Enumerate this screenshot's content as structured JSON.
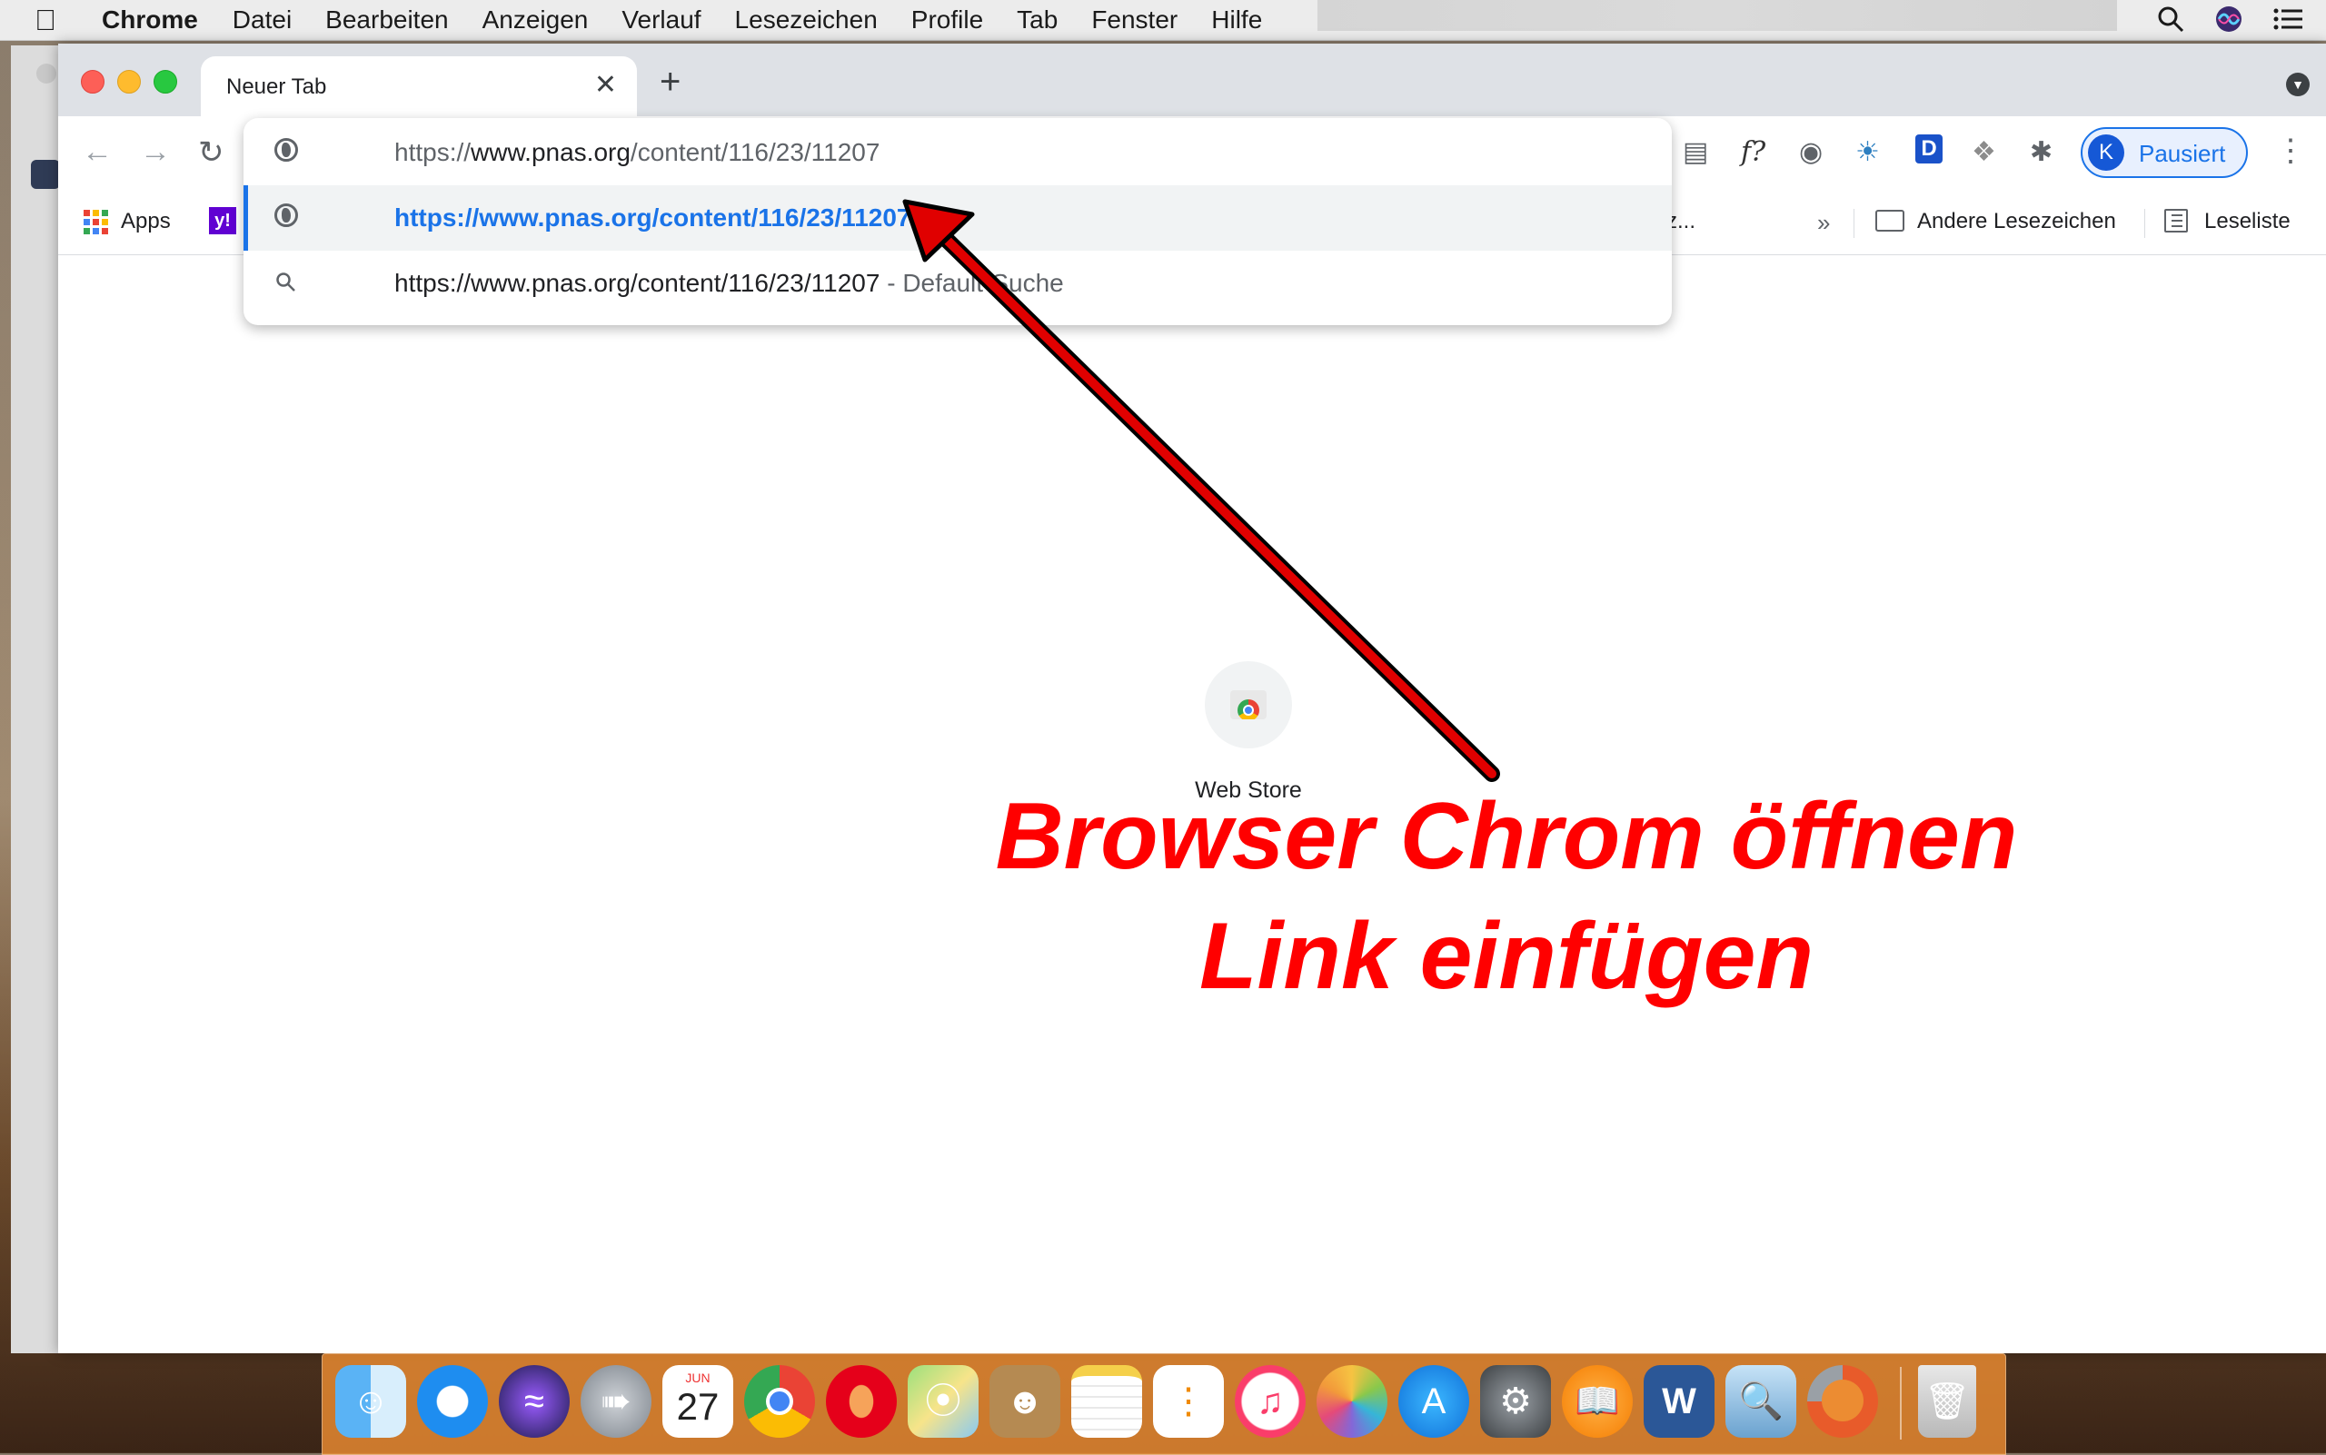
{
  "menubar": {
    "apple": "",
    "app": "Chrome",
    "items": [
      "Datei",
      "Bearbeiten",
      "Anzeigen",
      "Verlauf",
      "Lesezeichen",
      "Profile",
      "Tab",
      "Fenster",
      "Hilfe"
    ]
  },
  "tab": {
    "title": "Neuer Tab",
    "close": "✕"
  },
  "newtab": "+",
  "omnibox": {
    "input_prefix": "https://",
    "input_host": "www.pnas.org",
    "input_path": "/content/116/23/11207",
    "suggestion_url": "https://www.pnas.org/content/116/23/11207",
    "search_query": "https://www.pnas.org/content/116/23/11207",
    "search_suffix": " - Default-Suche"
  },
  "extensions": {
    "fx": "f?",
    "d": "D"
  },
  "profile": {
    "initial": "K",
    "label": "Pausiert"
  },
  "bookmarks": {
    "apps": "Apps",
    "yahoo": "y!",
    "truncated": "z...",
    "more": "»",
    "other": "Andere Lesezeichen",
    "reading": "Leseliste"
  },
  "shortcut": {
    "label": "Web Store"
  },
  "annotation": {
    "line1": "Browser Chrom öffnen",
    "line2": "Link einfügen",
    "color": "#ff0000"
  },
  "dock": {
    "calendar_month": "JUN",
    "calendar_day": "27",
    "word": "W"
  },
  "colors": {
    "accent": "#1a73e8",
    "tabstrip": "#dee1e6"
  }
}
